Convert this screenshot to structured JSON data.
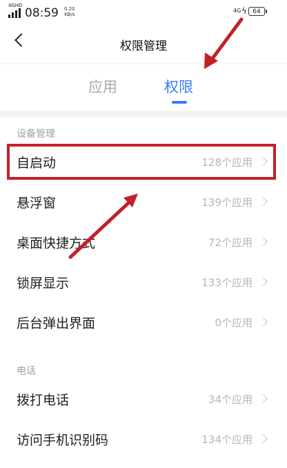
{
  "status_bar": {
    "signal_label": "4GHD",
    "time": "08:59",
    "net_speed_value": "0.20",
    "net_speed_unit": "KB/s",
    "network_type": "4G",
    "battery_level": "64"
  },
  "header": {
    "back_icon": "chevron-left-icon",
    "title": "权限管理"
  },
  "tabs": [
    {
      "label": "应用",
      "selected": false
    },
    {
      "label": "权限",
      "selected": true
    }
  ],
  "accent_color": "#3b7cf6",
  "annotation_color": "#c4202a",
  "sections": [
    {
      "title": "设备管理",
      "items": [
        {
          "label": "自启动",
          "count": "128个应用"
        },
        {
          "label": "悬浮窗",
          "count": "139个应用"
        },
        {
          "label": "桌面快捷方式",
          "count": "72个应用"
        },
        {
          "label": "锁屏显示",
          "count": "133个应用"
        },
        {
          "label": "后台弹出界面",
          "count": "0个应用"
        }
      ]
    },
    {
      "title": "电话",
      "items": [
        {
          "label": "拨打电话",
          "count": "34个应用"
        },
        {
          "label": "访问手机识别码",
          "count": "134个应用"
        }
      ]
    }
  ]
}
